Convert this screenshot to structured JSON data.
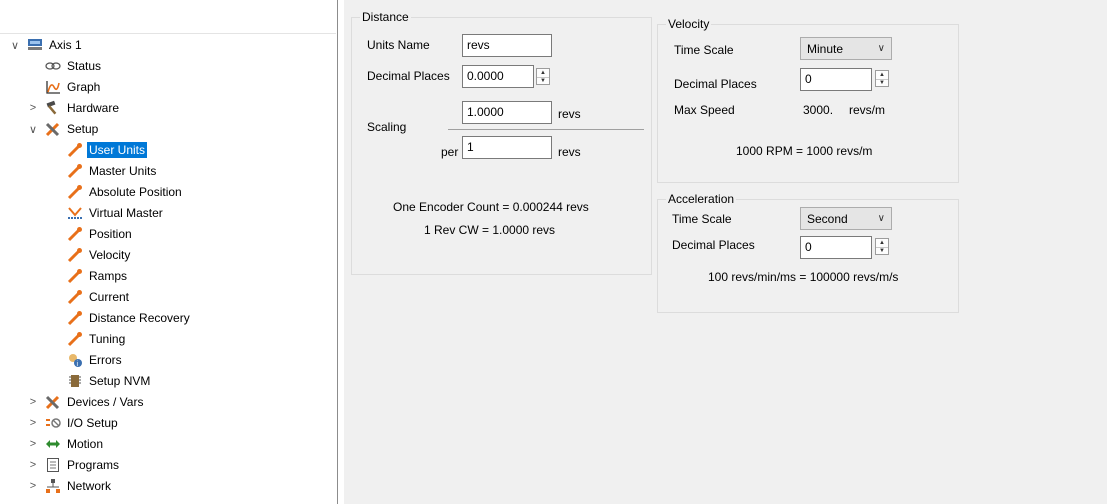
{
  "tree": {
    "items": [
      {
        "label": "Axis 1",
        "chevron": "∨",
        "icon": "controller-icon"
      },
      {
        "label": "Status",
        "chevron": "",
        "icon": "link-icon"
      },
      {
        "label": "Graph",
        "chevron": "",
        "icon": "graph-icon"
      },
      {
        "label": "Hardware",
        "chevron": ">",
        "icon": "hammer-icon"
      },
      {
        "label": "Setup",
        "chevron": "∨",
        "icon": "tools-icon"
      },
      {
        "label": "User Units",
        "chevron": "",
        "icon": "wrench-icon"
      },
      {
        "label": "Master Units",
        "chevron": "",
        "icon": "wrench-icon"
      },
      {
        "label": "Absolute Position",
        "chevron": "",
        "icon": "wrench-icon"
      },
      {
        "label": "Virtual Master",
        "chevron": "",
        "icon": "virtual-master-icon"
      },
      {
        "label": "Position",
        "chevron": "",
        "icon": "wrench-icon"
      },
      {
        "label": "Velocity",
        "chevron": "",
        "icon": "wrench-icon"
      },
      {
        "label": "Ramps",
        "chevron": "",
        "icon": "wrench-icon"
      },
      {
        "label": "Current",
        "chevron": "",
        "icon": "wrench-icon"
      },
      {
        "label": "Distance Recovery",
        "chevron": "",
        "icon": "wrench-icon"
      },
      {
        "label": "Tuning",
        "chevron": "",
        "icon": "wrench-icon"
      },
      {
        "label": "Errors",
        "chevron": "",
        "icon": "errors-icon"
      },
      {
        "label": "Setup NVM",
        "chevron": "",
        "icon": "memory-chip-icon"
      },
      {
        "label": "Devices / Vars",
        "chevron": ">",
        "icon": "tools-icon"
      },
      {
        "label": "I/O Setup",
        "chevron": ">",
        "icon": "io-icon"
      },
      {
        "label": "Motion",
        "chevron": ">",
        "icon": "arrows-icon"
      },
      {
        "label": "Programs",
        "chevron": ">",
        "icon": "document-icon"
      },
      {
        "label": "Network",
        "chevron": ">",
        "icon": "network-icon"
      }
    ],
    "selected_label": "User Units"
  },
  "distance": {
    "title": "Distance",
    "units_name_label": "Units Name",
    "units_name_value": "revs",
    "decimal_places_label": "Decimal Places",
    "decimal_places_value": "0.0000",
    "scaling_label": "Scaling",
    "scaling_numerator": "1.0000",
    "scaling_numerator_unit": "revs",
    "per_label": "per",
    "scaling_denominator": "1",
    "scaling_denominator_unit": "revs",
    "encoder_count_text": "One Encoder Count = 0.000244 revs",
    "rev_cw_text": "1 Rev CW = 1.0000 revs"
  },
  "velocity": {
    "title": "Velocity",
    "time_scale_label": "Time Scale",
    "time_scale_value": "Minute",
    "decimal_places_label": "Decimal Places",
    "decimal_places_value": "0",
    "max_speed_label": "Max Speed",
    "max_speed_value": "3000.",
    "max_speed_unit": "revs/m",
    "conversion_text": "1000 RPM = 1000 revs/m"
  },
  "acceleration": {
    "title": "Acceleration",
    "time_scale_label": "Time Scale",
    "time_scale_value": "Second",
    "decimal_places_label": "Decimal Places",
    "decimal_places_value": "0",
    "conversion_text": "100 revs/min/ms = 100000 revs/m/s"
  },
  "colors": {
    "selection": "#0078d7",
    "panel_background": "#f0f0f0",
    "wrench_orange": "#e8701a"
  }
}
